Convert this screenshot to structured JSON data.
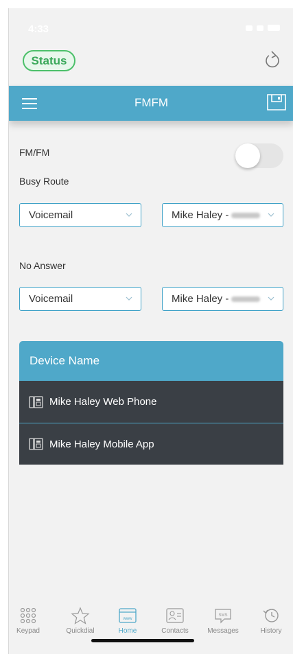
{
  "statusbar": {
    "time": "4:33"
  },
  "header": {
    "status_label": "Status",
    "title": "FMFM"
  },
  "settings": {
    "fmfm_label": "FM/FM",
    "fmfm_enabled": false,
    "busy_route_label": "Busy Route",
    "busy_route_action": "Voicemail",
    "busy_route_target": "Mike Haley -",
    "no_answer_label": "No Answer",
    "no_answer_action": "Voicemail",
    "no_answer_target": "Mike Haley -"
  },
  "devices": {
    "header": "Device Name",
    "items": [
      {
        "label": "Mike Haley Web Phone"
      },
      {
        "label": "Mike Haley Mobile App"
      }
    ]
  },
  "tabs": [
    {
      "label": "Keypad",
      "icon": "keypad-icon"
    },
    {
      "label": "Quickdial",
      "icon": "star-icon"
    },
    {
      "label": "Home",
      "icon": "browser-icon",
      "active": true
    },
    {
      "label": "Contacts",
      "icon": "contact-card-icon"
    },
    {
      "label": "Messages",
      "icon": "sms-icon"
    },
    {
      "label": "History",
      "icon": "history-icon"
    }
  ],
  "colors": {
    "accent": "#4fa8c9",
    "status_green": "#3aa85a",
    "dark_row": "#3a3f45"
  }
}
